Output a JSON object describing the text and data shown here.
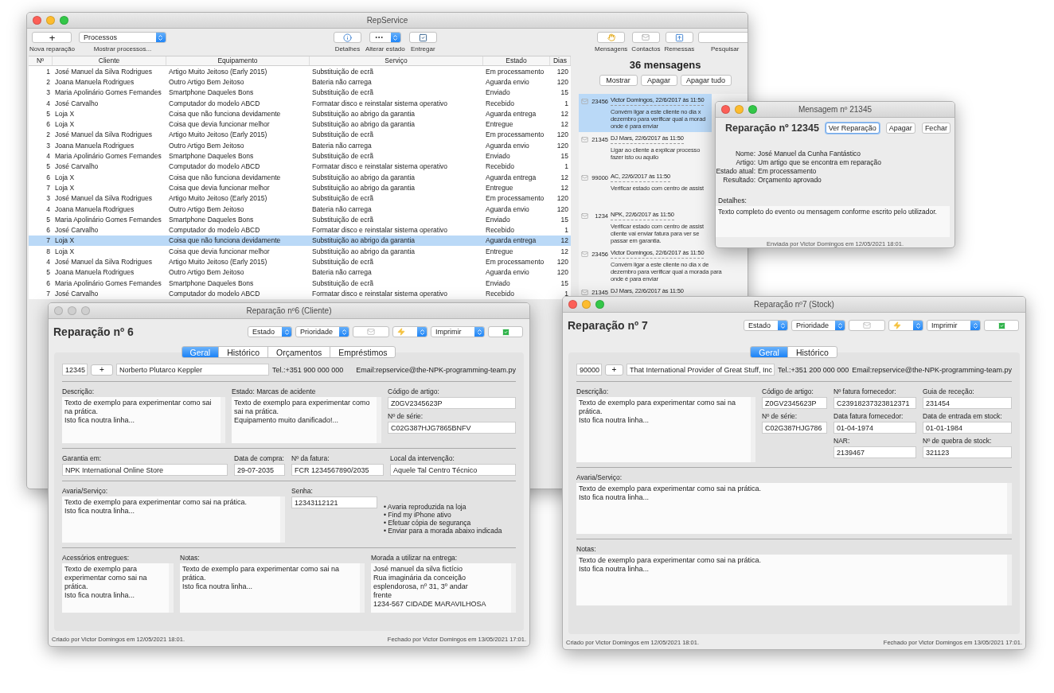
{
  "main_window": {
    "title": "RepService",
    "active": true,
    "toolbar": {
      "new_button": {
        "text": "+",
        "caption": "Nova reparação"
      },
      "process_popup": {
        "value": "Processos",
        "caption": "Mostrar processos..."
      },
      "details_button": {
        "caption": "Detalhes"
      },
      "state_popup": {
        "caption": "Alterar estado"
      },
      "deliver_button": {
        "caption": "Entregar"
      },
      "messages_button": {
        "caption": "Mensagens"
      },
      "contacts_button": {
        "caption": "Contactos"
      },
      "shipments_button": {
        "caption": "Remessas"
      },
      "search": {
        "caption": "Pesquisar"
      }
    },
    "table": {
      "columns": [
        "Nº",
        "Cliente",
        "Equipamento",
        "Serviço",
        "Estado",
        "Dias"
      ],
      "rows": [
        {
          "cells": [
            "1",
            "José Manuel da Silva Rodrigues",
            "Artigo Muito Jeitoso (Early 2015)",
            "Substituição de ecrã",
            "Em processamento",
            "120"
          ],
          "selected": false
        },
        {
          "cells": [
            "2",
            "Joana Manuela Rodrigues",
            "Outro Artigo Bem Jeitoso",
            "Bateria não carrega",
            "Aguarda envio",
            "120"
          ],
          "selected": false
        },
        {
          "cells": [
            "3",
            "Maria Apolinário Gomes Fernandes",
            "Smartphone Daqueles Bons",
            "Substituição de ecrã",
            "Enviado",
            "15"
          ],
          "selected": false
        },
        {
          "cells": [
            "4",
            "José Carvalho",
            "Computador do modelo ABCD",
            "Formatar disco e reinstalar sistema operativo",
            "Recebido",
            "1"
          ],
          "selected": false
        },
        {
          "cells": [
            "5",
            "Loja X",
            "Coisa que não funciona devidamente",
            "Substituição ao abrigo da garantia",
            "Aguarda entrega",
            "12"
          ],
          "selected": false
        },
        {
          "cells": [
            "6",
            "Loja X",
            "Coisa que devia funcionar melhor",
            "Substituição ao abrigo da garantia",
            "Entregue",
            "12"
          ],
          "selected": false
        },
        {
          "cells": [
            "2",
            "José Manuel da Silva Rodrigues",
            "Artigo Muito Jeitoso (Early 2015)",
            "Substituição de ecrã",
            "Em processamento",
            "120"
          ],
          "selected": false
        },
        {
          "cells": [
            "3",
            "Joana Manuela Rodrigues",
            "Outro Artigo Bem Jeitoso",
            "Bateria não carrega",
            "Aguarda envio",
            "120"
          ],
          "selected": false
        },
        {
          "cells": [
            "4",
            "Maria Apolinário Gomes Fernandes",
            "Smartphone Daqueles Bons",
            "Substituição de ecrã",
            "Enviado",
            "15"
          ],
          "selected": false
        },
        {
          "cells": [
            "5",
            "José Carvalho",
            "Computador do modelo ABCD",
            "Formatar disco e reinstalar sistema operativo",
            "Recebido",
            "1"
          ],
          "selected": false
        },
        {
          "cells": [
            "6",
            "Loja X",
            "Coisa que não funciona devidamente",
            "Substituição ao abrigo da garantia",
            "Aguarda entrega",
            "12"
          ],
          "selected": false
        },
        {
          "cells": [
            "7",
            "Loja X",
            "Coisa que devia funcionar melhor",
            "Substituição ao abrigo da garantia",
            "Entregue",
            "12"
          ],
          "selected": false
        },
        {
          "cells": [
            "3",
            "José Manuel da Silva Rodrigues",
            "Artigo Muito Jeitoso (Early 2015)",
            "Substituição de ecrã",
            "Em processamento",
            "120"
          ],
          "selected": false
        },
        {
          "cells": [
            "4",
            "Joana Manuela Rodrigues",
            "Outro Artigo Bem Jeitoso",
            "Bateria não carrega",
            "Aguarda envio",
            "120"
          ],
          "selected": false
        },
        {
          "cells": [
            "5",
            "Maria Apolinário Gomes Fernandes",
            "Smartphone Daqueles Bons",
            "Substituição de ecrã",
            "Enviado",
            "15"
          ],
          "selected": false
        },
        {
          "cells": [
            "6",
            "José Carvalho",
            "Computador do modelo ABCD",
            "Formatar disco e reinstalar sistema operativo",
            "Recebido",
            "1"
          ],
          "selected": false
        },
        {
          "cells": [
            "7",
            "Loja X",
            "Coisa que não funciona devidamente",
            "Substituição ao abrigo da garantia",
            "Aguarda entrega",
            "12"
          ],
          "selected": true
        },
        {
          "cells": [
            "8",
            "Loja X",
            "Coisa que devia funcionar melhor",
            "Substituição ao abrigo da garantia",
            "Entregue",
            "12"
          ],
          "selected": false
        },
        {
          "cells": [
            "4",
            "José Manuel da Silva Rodrigues",
            "Artigo Muito Jeitoso (Early 2015)",
            "Substituição de ecrã",
            "Em processamento",
            "120"
          ],
          "selected": false
        },
        {
          "cells": [
            "5",
            "Joana Manuela Rodrigues",
            "Outro Artigo Bem Jeitoso",
            "Bateria não carrega",
            "Aguarda envio",
            "120"
          ],
          "selected": false
        },
        {
          "cells": [
            "6",
            "Maria Apolinário Gomes Fernandes",
            "Smartphone Daqueles Bons",
            "Substituição de ecrã",
            "Enviado",
            "15"
          ],
          "selected": false
        },
        {
          "cells": [
            "7",
            "José Carvalho",
            "Computador do modelo ABCD",
            "Formatar disco e reinstalar sistema operativo",
            "Recebido",
            "1"
          ],
          "selected": false
        }
      ]
    },
    "messages": {
      "title": "36 mensagens",
      "buttons": [
        "Mostrar",
        "Apagar",
        "Apagar tudo"
      ],
      "items": [
        {
          "number": "23456",
          "header": "Victor Domingos, 22/6/2017 às 11:50",
          "body": "Convém ligar a este cliente no dia x\ndezembro para verificar qual a morad\nonde é para enviar",
          "selected": true
        },
        {
          "number": "21345",
          "header": "DJ Mars, 22/6/2017 às 11:50",
          "body": "Ligar ao cliente a explicar processo\nfazer isto ou aquilo",
          "selected": false
        },
        {
          "number": "99000",
          "header": "AC, 22/6/2017 às 11:50",
          "body": "Verificar estado com centro de assist",
          "selected": false
        },
        {
          "number": "1234",
          "header": "NPK, 22/6/2017 às 11:50",
          "body": "Verificar estado com centro de assist\ncliente vai enviar fatura para ver se\npassar em garantia.",
          "selected": false
        },
        {
          "number": "23456",
          "header": "Victor Domingos, 22/6/2017 às 11:50",
          "body": "Convém ligar a este cliente no dia x de\ndezembro para verificar qual a morada para\nonde é para enviar",
          "selected": false
        },
        {
          "number": "21345",
          "header": "DJ Mars, 22/6/2017 às 11:50",
          "selected": false
        }
      ]
    }
  },
  "message_window": {
    "title": "Mensagem nº 21345",
    "active": true,
    "heading": "Reparação nº 12345",
    "buttons": [
      {
        "label": "Ver Reparação",
        "default": true
      },
      {
        "label": "Apagar",
        "default": false
      },
      {
        "label": "Fechar",
        "default": false
      }
    ],
    "fields": [
      {
        "label": "Nome:",
        "value": "José Manuel da Cunha Fantástico"
      },
      {
        "label": "Artigo:",
        "value": "Um artigo que se encontra em reparação"
      },
      {
        "label": "Estado atual:",
        "value": "Em processamento"
      },
      {
        "label": "Resultado:",
        "value": "Orçamento aprovado"
      }
    ],
    "details_label": "Detalhes:",
    "details": "Texto completo do evento ou mensagem conforme escrito pelo utilizador.",
    "footer": "Enviada por Victor Domingos em 12/05/2021 18:01."
  },
  "repair_client_window": {
    "title": "Reparação nº6 (Cliente)",
    "active": false,
    "heading": "Reparação nº 6",
    "toolbar": [
      {
        "kind": "popup",
        "label": "Estado"
      },
      {
        "kind": "popup",
        "label": "Prioridade"
      },
      {
        "kind": "mail"
      },
      {
        "kind": "flash"
      },
      {
        "kind": "popup",
        "label": "Imprimir"
      },
      {
        "kind": "confirm"
      }
    ],
    "tabs": [
      {
        "label": "Geral",
        "selected": true
      },
      {
        "label": "Histórico",
        "selected": false
      },
      {
        "label": "Orçamentos",
        "selected": false
      },
      {
        "label": "Empréstimos",
        "selected": false
      }
    ],
    "customer": {
      "id": "12345",
      "add_button": "+",
      "name": "Norberto Plutarco Keppler",
      "phone": "Tel.:+351 900 000 000",
      "email": "Email:repservice@the-NPK-programming-team.py"
    },
    "sections": [
      [
        {
          "kind": "textarea",
          "label": "Descrição:",
          "value": "Texto de exemplo para experimentar como sai na prática.\nIsto fica noutra linha..."
        },
        {
          "kind": "textarea",
          "label": "Estado: Marcas de acidente",
          "value": "Texto de exemplo para experimentar como sai na prática.\n Equipamento muito danificado!..."
        },
        {
          "kind": "stack",
          "children": [
            {
              "kind": "field",
              "label": "Código de artigo:",
              "value": "Z0GV2345623P"
            },
            {
              "kind": "field",
              "label": "Nº de série:",
              "value": "C02G387HJG7865BNFV"
            }
          ]
        }
      ],
      [
        {
          "kind": "field",
          "label": "Garantia em:",
          "value": "NPK International Online Store"
        },
        {
          "kind": "field",
          "label": "Data de compra:",
          "value": "29-07-2035"
        },
        {
          "kind": "field",
          "label": "Nº da fatura:",
          "value": "FCR 1234567890/2035"
        },
        {
          "kind": "field",
          "label": "Local da intervenção:",
          "value": "Aquele Tal Centro Técnico"
        }
      ],
      [
        {
          "kind": "textarea",
          "label": "Avaria/Serviço:",
          "value": "Texto de exemplo para experimentar como sai na prática.\nIsto fica noutra linha..."
        },
        {
          "kind": "field",
          "label": "Senha:",
          "value": "12343112121"
        },
        {
          "kind": "note",
          "value": "• Avaria reproduzida na loja\n• Find my iPhone ativo\n• Efetuar cópia de segurança\n• Enviar para a morada abaixo indicada"
        }
      ],
      [
        {
          "kind": "textarea",
          "label": "Acessórios entregues:",
          "value": "Texto de exemplo para experimentar como sai na prática.\nIsto fica noutra linha..."
        },
        {
          "kind": "textarea",
          "label": "Notas:",
          "value": "Texto de exemplo para experimentar como sai na prática.\nIsto fica noutra linha..."
        },
        {
          "kind": "textarea",
          "label": "Morada a utilizar na entrega:",
          "value": "José manuel da silva fictício\nRua imaginária da conceição\nesplendorosa, nº 31, 3º andar\nfrente\n1234-567 CIDADE MARAVILHOSA"
        }
      ]
    ],
    "footer": {
      "created": "Criado por Victor Domingos em 12/05/2021 18:01.",
      "closed": "Fechado por Victor Domingos em 13/05/2021 17:01."
    }
  },
  "repair_stock_window": {
    "title": "Reparação nº7 (Stock)",
    "active": true,
    "heading": "Reparação nº 7",
    "toolbar": [
      {
        "kind": "popup",
        "label": "Estado"
      },
      {
        "kind": "popup",
        "label": "Prioridade"
      },
      {
        "kind": "mail"
      },
      {
        "kind": "flash"
      },
      {
        "kind": "popup",
        "label": "Imprimir"
      },
      {
        "kind": "confirm"
      }
    ],
    "tabs": [
      {
        "label": "Geral",
        "selected": true
      },
      {
        "label": "Histórico",
        "selected": false
      }
    ],
    "customer": {
      "id": "90000",
      "add_button": "+",
      "name": "That International Provider of Great Stuff, Inc",
      "phone": "Tel.:+351 200 000 000",
      "email": "Email:repservice@the-NPK-programming-team.py"
    },
    "sections": [
      [
        {
          "kind": "textarea",
          "label": "Descrição:",
          "value": "Texto de exemplo para experimentar como sai na prática.\nIsto fica noutra linha..."
        },
        {
          "kind": "stack",
          "children": [
            {
              "kind": "field",
              "label": "Código de artigo:",
              "value": "Z0GV2345623P"
            },
            {
              "kind": "field",
              "label": "Nº de série:",
              "value": "C02G387HJG786"
            }
          ]
        },
        {
          "kind": "stack",
          "children": [
            {
              "kind": "field",
              "label": "Nº fatura fornecedor:",
              "value": "C23918237323812371"
            },
            {
              "kind": "field",
              "label": "Data fatura fornecedor:",
              "value": "01-04-1974"
            },
            {
              "kind": "field",
              "label": "NAR:",
              "value": "2139467"
            }
          ]
        },
        {
          "kind": "stack",
          "children": [
            {
              "kind": "field",
              "label": "Guia de receção:",
              "value": "231454"
            },
            {
              "kind": "field",
              "label": "Data de entrada em stock:",
              "value": "01-01-1984"
            },
            {
              "kind": "field",
              "label": "Nº de quebra de stock:",
              "value": "321123"
            }
          ]
        }
      ],
      [
        {
          "kind": "textarea",
          "label": "Avaria/Serviço:",
          "value": "Texto de exemplo para experimentar como sai na prática.\nIsto fica noutra linha..."
        }
      ],
      [
        {
          "kind": "textarea",
          "label": "Notas:",
          "value": "Texto de exemplo para experimentar como sai na prática.\nIsto fica noutra linha..."
        }
      ]
    ],
    "footer": {
      "created": "Criado por Victor Domingos em 12/05/2021 18:01.",
      "closed": "Fechado por Victor Domingos em 13/05/2021 17:01."
    }
  }
}
